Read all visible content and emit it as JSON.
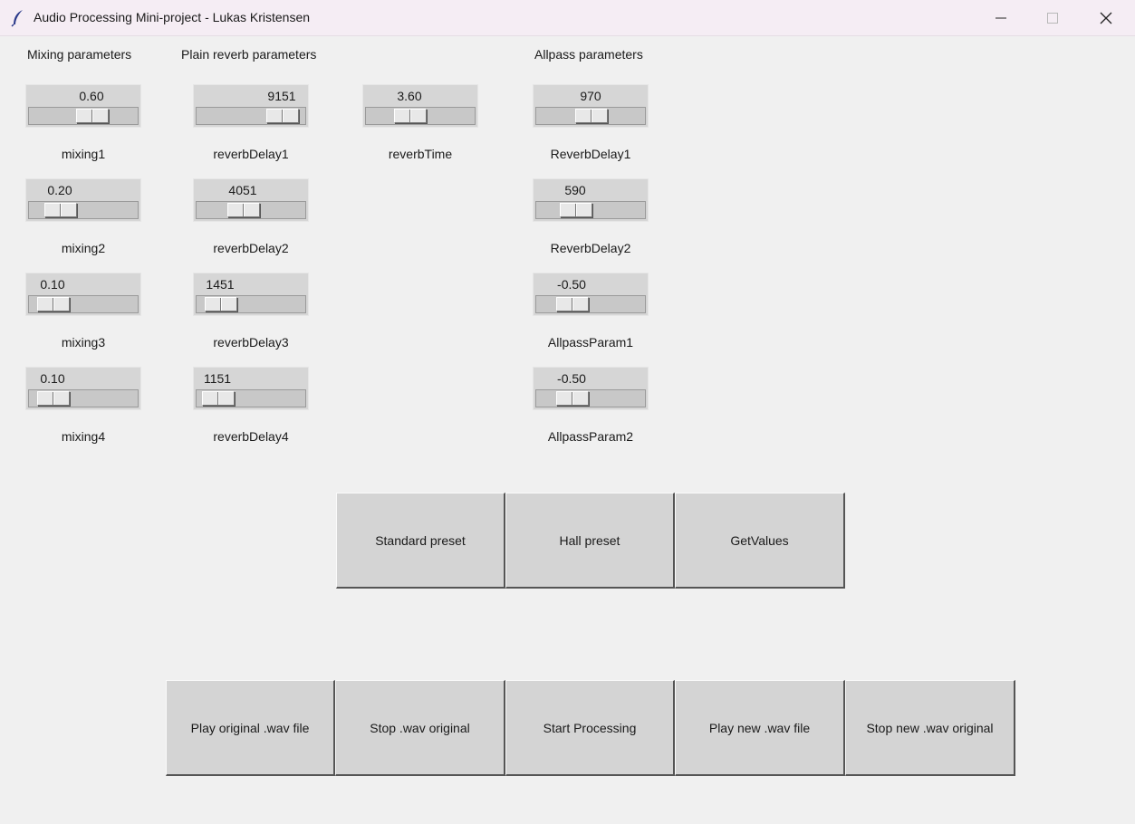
{
  "window": {
    "title": "Audio Processing Mini-project - Lukas Kristensen",
    "icon": "feather-icon",
    "controls": [
      "minimize-icon",
      "maximize-icon",
      "close-icon"
    ]
  },
  "sections": {
    "mixing": "Mixing parameters",
    "reverb": "Plain reverb parameters",
    "allpass": "Allpass parameters"
  },
  "scales": {
    "mixing1": {
      "value": "0.60",
      "label": "mixing1",
      "level": 0.6
    },
    "mixing2": {
      "value": "0.20",
      "label": "mixing2",
      "level": 0.2
    },
    "mixing3": {
      "value": "0.10",
      "label": "mixing3",
      "level": 0.1
    },
    "mixing4": {
      "value": "0.10",
      "label": "mixing4",
      "level": 0.1
    },
    "reverbDelay1": {
      "value": "9151",
      "label": "reverbDelay1",
      "level": 0.89
    },
    "reverbDelay2": {
      "value": "4051",
      "label": "reverbDelay2",
      "level": 0.4
    },
    "reverbDelay3": {
      "value": "1451",
      "label": "reverbDelay3",
      "level": 0.1
    },
    "reverbDelay4": {
      "value": "1151",
      "label": "reverbDelay4",
      "level": 0.07
    },
    "reverbTime": {
      "value": "3.60",
      "label": "reverbTime",
      "level": 0.36
    },
    "allpassDelay1": {
      "value": "970",
      "label": "ReverbDelay1",
      "level": 0.5
    },
    "allpassDelay2": {
      "value": "590",
      "label": "ReverbDelay2",
      "level": 0.3
    },
    "allpassParam1": {
      "value": "-0.50",
      "label": "AllpassParam1",
      "level": 0.25
    },
    "allpassParam2": {
      "value": "-0.50",
      "label": "AllpassParam2",
      "level": 0.25
    }
  },
  "presets": {
    "standard": "Standard preset",
    "hall": "Hall preset",
    "getvalues": "GetValues"
  },
  "transport": {
    "play_original": "Play original .wav file",
    "stop_original": "Stop .wav original",
    "start_processing": "Start Processing",
    "play_new": "Play new .wav file",
    "stop_new": "Stop new .wav original"
  },
  "colors": {
    "background": "#f0f0f0",
    "titlebar": "#f5edf4",
    "widget": "#d6d6d6"
  }
}
